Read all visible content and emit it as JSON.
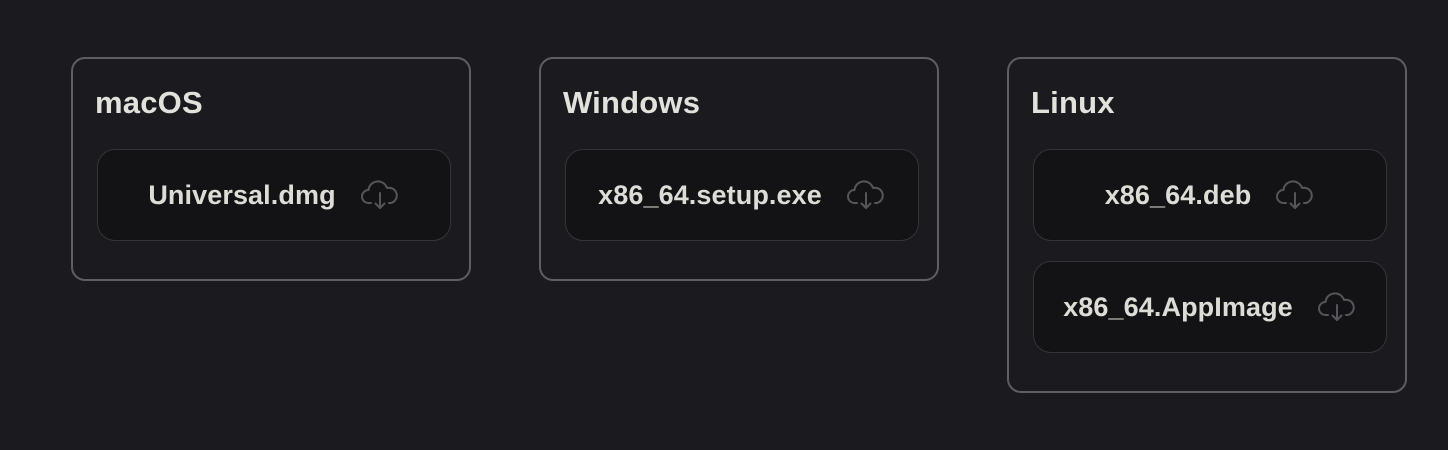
{
  "platforms": [
    {
      "title": "macOS",
      "downloads": [
        {
          "label": "Universal.dmg",
          "icon": "cloud-download-icon"
        }
      ]
    },
    {
      "title": "Windows",
      "downloads": [
        {
          "label": "x86_64.setup.exe",
          "icon": "cloud-download-icon"
        }
      ]
    },
    {
      "title": "Linux",
      "downloads": [
        {
          "label": "x86_64.deb",
          "icon": "cloud-download-icon"
        },
        {
          "label": "x86_64.AppImage",
          "icon": "cloud-download-icon"
        }
      ]
    }
  ],
  "colors": {
    "background": "#1b1b1f",
    "card_border": "#5e5e63",
    "button_bg": "#131316",
    "button_border": "#33333a",
    "text": "#e2e1dc",
    "icon": "#55555c"
  }
}
